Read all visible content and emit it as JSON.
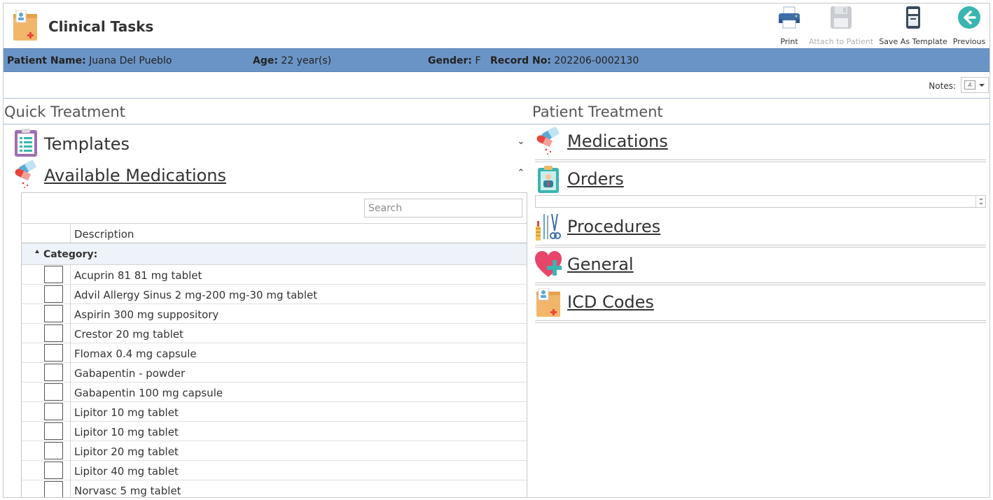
{
  "header": {
    "title": "Clinical Tasks",
    "app_icon": "patient-folder-icon"
  },
  "toolbar": {
    "print_label": "Print",
    "attach_label": "Attach to Patient",
    "save_template_label": "Save As Template",
    "previous_label": "Previous"
  },
  "patient": {
    "name_label": "Patient Name:",
    "name": "Juana Del Pueblo",
    "age_label": "Age:",
    "age": "22 year(s)",
    "gender_label": "Gender:",
    "gender": "F",
    "record_label": "Record No:",
    "record": "202206-0002130"
  },
  "notes": {
    "label": "Notes:"
  },
  "quick_treatment": {
    "title": "Quick Treatment",
    "templates_label": "Templates",
    "available_label": "Available Medications",
    "search_placeholder": "Search",
    "column_description": "Description",
    "group_label": "Category:",
    "rows": [
      "Acuprin 81 81 mg tablet",
      "Advil Allergy Sinus 2 mg-200 mg-30 mg tablet",
      "Aspirin 300 mg suppository",
      "Crestor 20 mg tablet",
      "Flomax 0.4 mg capsule",
      "Gabapentin - powder",
      "Gabapentin 100 mg capsule",
      "Lipitor 10 mg tablet",
      "Lipitor 10 mg tablet",
      "Lipitor 20 mg tablet",
      "Lipitor 40 mg tablet",
      "Norvasc 5 mg tablet"
    ]
  },
  "patient_treatment": {
    "title": "Patient Treatment",
    "medications_label": "Medications",
    "orders_label": "Orders",
    "procedures_label": "Procedures",
    "general_label": "General",
    "icd_label": "ICD Codes"
  },
  "colors": {
    "patient_bar": "#6b94c6",
    "accent_teal": "#3ab5b0",
    "divider": "#a9bcd6"
  }
}
